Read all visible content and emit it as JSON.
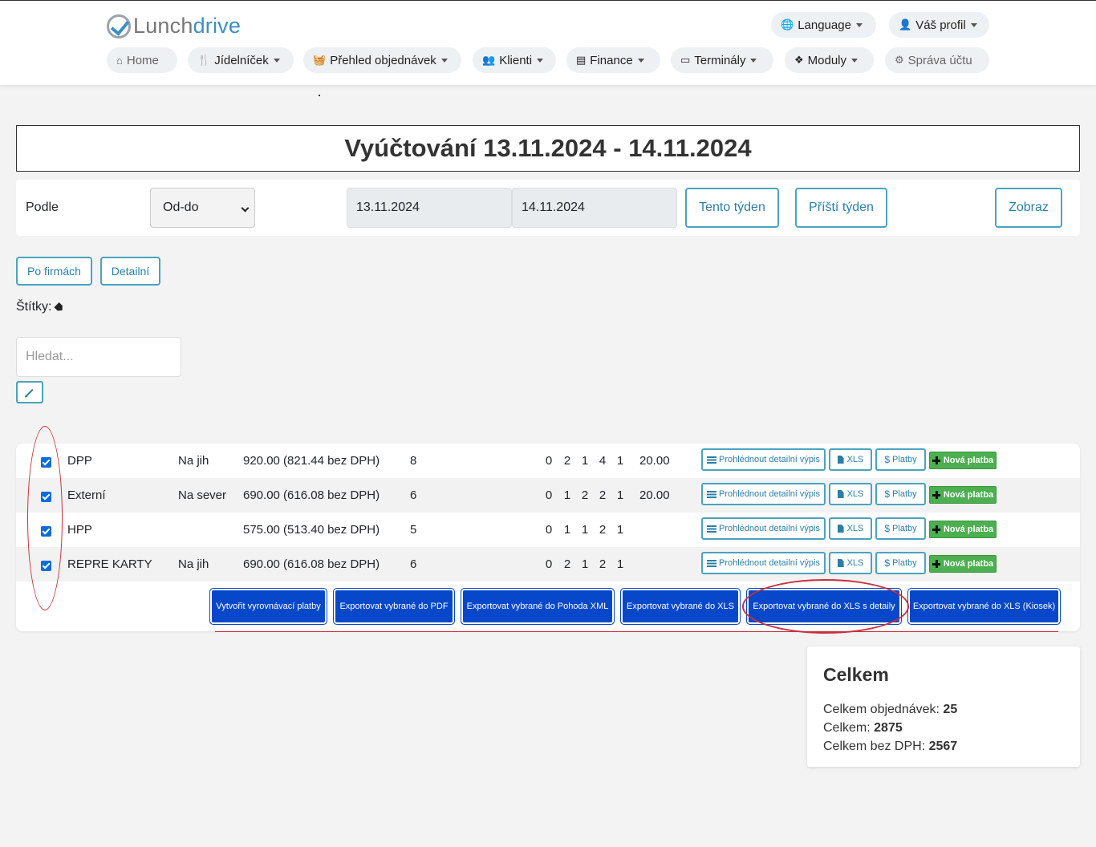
{
  "brand": {
    "name_part1": "Lunch",
    "name_part2": "drive"
  },
  "header": {
    "language_label": "Language",
    "profile_label": "Váš profil"
  },
  "nav": {
    "home": "Home",
    "jidelnicek": "Jídelníček",
    "prehled": "Přehled objednávek",
    "klienti": "Klienti",
    "finance": "Finance",
    "terminaly": "Terminály",
    "moduly": "Moduly",
    "sprava": "Správa účtu"
  },
  "page": {
    "title": "Vyúčtování 13.11.2024 - 14.11.2024"
  },
  "filter": {
    "podle_label": "Podle",
    "mode_selected": "Od-do",
    "date_from": "13.11.2024",
    "date_to": "14.11.2024",
    "this_week": "Tento týden",
    "next_week": "Příští týden",
    "show": "Zobraz"
  },
  "views": {
    "by_company": "Po firmách",
    "detailed": "Detailní"
  },
  "tags_label": "Štítky:",
  "search": {
    "placeholder": "Hledat..."
  },
  "row_buttons": {
    "detail": "Prohlédnout detailní výpis",
    "xls": "XLS",
    "payments": "Platby",
    "new_payment": "Nová platba",
    "payments_symbol": "$"
  },
  "rows": [
    {
      "name": "DPP",
      "direction": "Na jih",
      "amount": "920.00 (821.44 bez DPH)",
      "count": "8",
      "n": [
        "0",
        "2",
        "1",
        "4",
        "1"
      ],
      "fee": "20.00",
      "checked": true
    },
    {
      "name": "Externí",
      "direction": "Na sever",
      "amount": "690.00 (616.08 bez DPH)",
      "count": "6",
      "n": [
        "0",
        "1",
        "2",
        "2",
        "1"
      ],
      "fee": "20.00",
      "checked": true
    },
    {
      "name": "HPP",
      "direction": "",
      "amount": "575.00 (513.40 bez DPH)",
      "count": "5",
      "n": [
        "0",
        "1",
        "1",
        "2",
        "1"
      ],
      "fee": "",
      "checked": true
    },
    {
      "name": "REPRE KARTY",
      "direction": "Na jih",
      "amount": "690.00 (616.08 bez DPH)",
      "count": "6",
      "n": [
        "0",
        "2",
        "1",
        "2",
        "1"
      ],
      "fee": "",
      "checked": true
    }
  ],
  "actions": {
    "equalize": "Vytvořit vyrovnávací platby",
    "pdf": "Exportovat vybrané do PDF",
    "pohoda": "Exportovat vybrané do Pohoda XML",
    "xls": "Exportovat vybrané do XLS",
    "xls_details": "Exportovat vybrané do XLS s detaily",
    "xls_kiosek": "Exportovat vybrané do XLS (Kiosek)"
  },
  "totals": {
    "heading": "Celkem",
    "orders_label": "Celkem objednávek:",
    "orders_value": "25",
    "total_label": "Celkem:",
    "total_value": "2875",
    "net_label": "Celkem bez DPH:",
    "net_value": "2567"
  },
  "colors": {
    "accent": "#2a7fa8",
    "primary_button": "#0747c9",
    "success": "#4caf50",
    "annotation": "#c9303c"
  }
}
